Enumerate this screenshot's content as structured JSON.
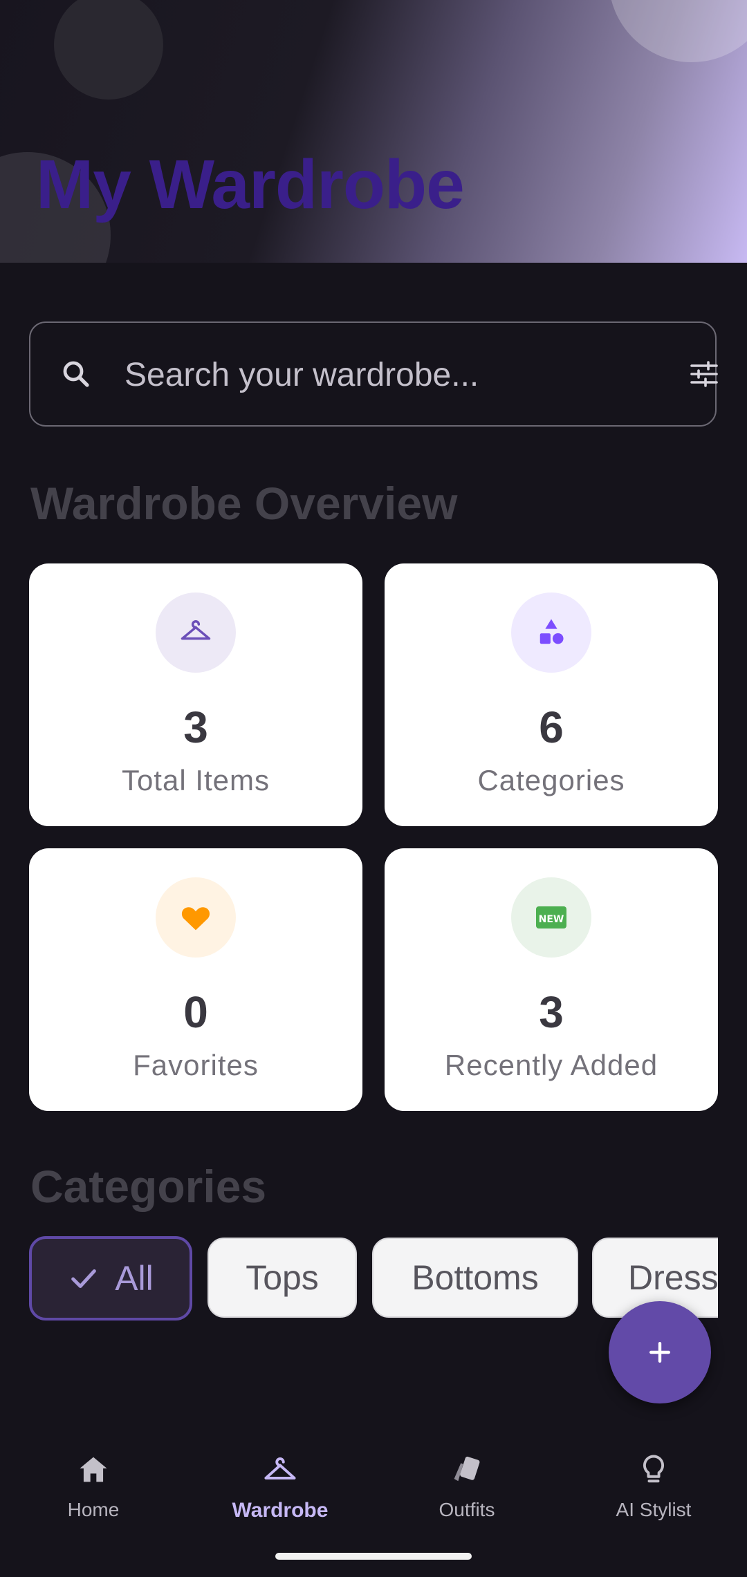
{
  "header": {
    "title": "My Wardrobe"
  },
  "search": {
    "placeholder": "Search your wardrobe...",
    "value": ""
  },
  "overview": {
    "title": "Wardrobe Overview",
    "cards": [
      {
        "value": "3",
        "label": "Total Items",
        "icon": "hanger-icon",
        "color": "#6b4fb8"
      },
      {
        "value": "6",
        "label": "Categories",
        "icon": "shapes-icon",
        "color": "#7c4dff"
      },
      {
        "value": "0",
        "label": "Favorites",
        "icon": "heart-icon",
        "color": "#ff9800"
      },
      {
        "value": "3",
        "label": "Recently Added",
        "icon": "new-badge-icon",
        "color": "#4caf50"
      }
    ]
  },
  "categories": {
    "title": "Categories",
    "chips": [
      {
        "label": "All",
        "selected": true
      },
      {
        "label": "Tops",
        "selected": false
      },
      {
        "label": "Bottoms",
        "selected": false
      },
      {
        "label": "Dresses",
        "selected": false
      }
    ]
  },
  "nav": {
    "items": [
      {
        "label": "Home",
        "icon": "home-icon",
        "active": false
      },
      {
        "label": "Wardrobe",
        "icon": "hanger-icon",
        "active": true
      },
      {
        "label": "Outfits",
        "icon": "cards-icon",
        "active": false
      },
      {
        "label": "AI Stylist",
        "icon": "lightbulb-icon",
        "active": false
      }
    ]
  },
  "colors": {
    "accent": "#624aa8",
    "background": "#15131b",
    "title": "#3a1f8a"
  }
}
